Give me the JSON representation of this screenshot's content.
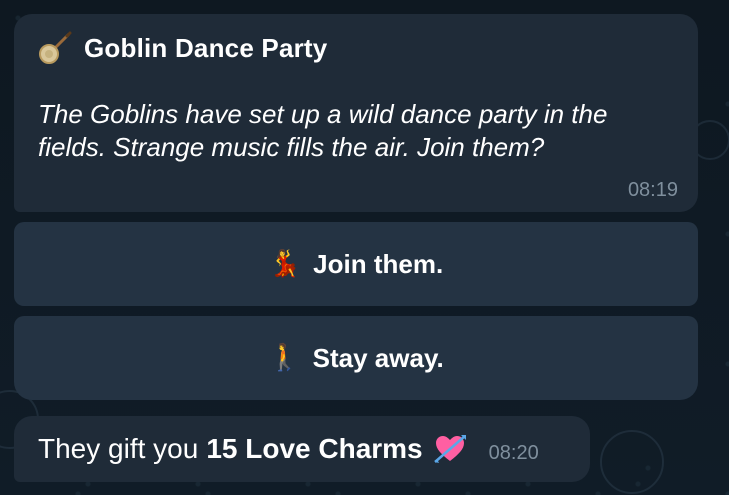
{
  "message": {
    "icon": "banjo-icon",
    "title": "Goblin Dance Party",
    "body": "The Goblins have set up a wild dance party in the fields. Strange music fills the air. Join them?",
    "time": "08:19"
  },
  "buttons": [
    {
      "icon": "dancing-person-icon",
      "emoji": "💃",
      "label": "Join them."
    },
    {
      "icon": "walking-person-icon",
      "emoji": "🚶",
      "label": "Stay away."
    }
  ],
  "reply": {
    "text_prefix": "They gift you",
    "text_bold": "15 Love Charms",
    "icon": "heart-with-arrow-icon",
    "time": "08:20"
  },
  "colors": {
    "background": "#0f1a24",
    "bubble": "#1f2b38",
    "button": "#243343",
    "time_text": "#7f8f9d",
    "text": "#ffffff"
  }
}
